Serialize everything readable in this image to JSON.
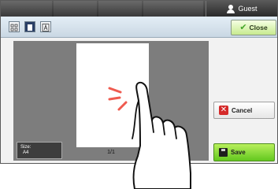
{
  "header": {
    "user_label": "Guest"
  },
  "toolbar": {
    "close_label": "Close"
  },
  "preview": {
    "page_counter": "1/1",
    "size_label": "Size:",
    "size_value": "A4"
  },
  "actions": {
    "cancel_label": "Cancel",
    "save_label": "Save"
  },
  "colors": {
    "save_accent": "#63c71f",
    "cancel_accent": "#d52a2a",
    "tap_accent": "#ef5a4f"
  },
  "icons": [
    "user-icon",
    "thumbnail-view-icon",
    "page-view-icon",
    "text-view-icon",
    "check-icon",
    "cancel-x-icon",
    "save-disk-icon",
    "hand-gesture-icon"
  ]
}
